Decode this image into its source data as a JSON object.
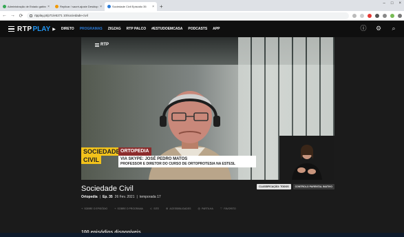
{
  "browser": {
    "tabs": [
      {
        "label": "Administração de Estado gabinet...",
        "favicon_color": "#34a853",
        "active": false
      },
      {
        "label": "Replicar / sacré-ajuste Desktop",
        "favicon_color": "#f29900",
        "active": false
      },
      {
        "label": "Sociedade Civil Episódio 35",
        "favicon_color": "#2b7bd8",
        "active": true
      }
    ],
    "url": "rtpplay.pt/p71/e5271 10/sociedade-civil",
    "new_tab_icon": "plus-icon"
  },
  "site": {
    "brand_main": "RTP",
    "brand_play": "PLAY",
    "nav": [
      {
        "label": "DIRETO",
        "current": false
      },
      {
        "label": "PROGRAMAS",
        "current": true
      },
      {
        "label": "ZIGZAG",
        "current": false
      },
      {
        "label": "RTP PALCO",
        "current": false
      },
      {
        "label": "#ESTUDOEMCASA",
        "current": false
      },
      {
        "label": "PODCASTS",
        "current": false
      },
      {
        "label": "APP",
        "current": false
      }
    ],
    "accent": "#2b7bd8"
  },
  "video": {
    "overlay_logo": "RTP",
    "lower_third": {
      "show_line1": "SOCIEDADE",
      "show_line2": "CIVIL",
      "topic": "ORTOPEDIA",
      "name": "VIA SKYPE: JOSÉ PEDRO MATOS",
      "role": "PROFESSOR E DIRETOR DO CURSO DE ORTOPROTESIA NA ESTESL"
    },
    "lower_third_colors": {
      "show": "#f2c21b",
      "topic": "#8c2c2c"
    }
  },
  "episode": {
    "show_title": "Sociedade Civil",
    "topic": "Ortopedia",
    "episode": "Ep. 35",
    "date": "26 Fev. 2021",
    "separator": "|",
    "season": "temporada 17",
    "badges": [
      "CLASSIFICAÇÃO: TODOS",
      "CONTROLO PARENTAL INATIVO"
    ],
    "actions": [
      {
        "label": "SOBRE O EPISÓDIO",
        "icon": "plus-icon"
      },
      {
        "label": "SOBRE O PROGRAMA",
        "icon": "plus-icon"
      },
      {
        "label": "SITE",
        "icon": "link-icon"
      },
      {
        "label": "ACESSIBILIDADES",
        "icon": "accessibility-icon"
      },
      {
        "label": "PARTILHA",
        "icon": "share-icon"
      },
      {
        "label": "FAVORITO",
        "icon": "heart-icon"
      }
    ]
  },
  "below": {
    "section_title": "100 episódios disponíveis"
  }
}
